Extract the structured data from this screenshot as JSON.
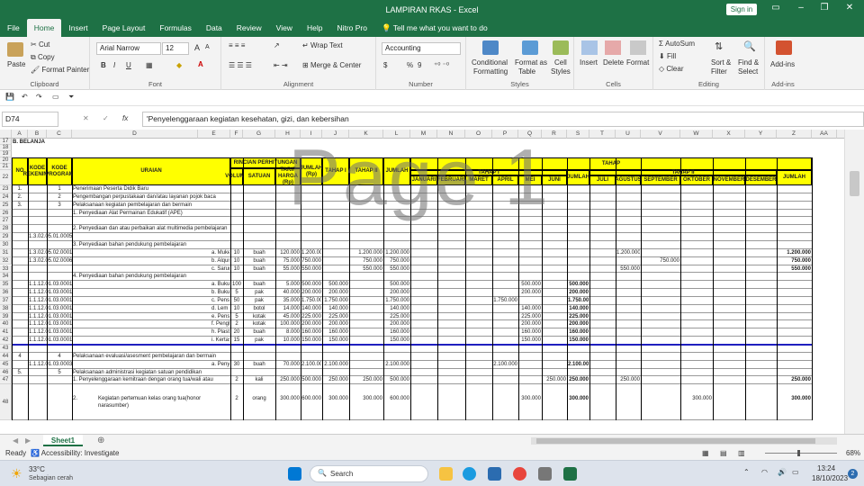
{
  "window": {
    "title": "LAMPIRAN RKAS  -  Excel",
    "signin": "Sign in"
  },
  "tabs": [
    "File",
    "Home",
    "Insert",
    "Page Layout",
    "Formulas",
    "Data",
    "Review",
    "View",
    "Help",
    "Nitro Pro"
  ],
  "tell_me": "Tell me what you want to do",
  "ribbon": {
    "clipboard": {
      "paste": "Paste",
      "cut": "Cut",
      "copy": "Copy",
      "format_painter": "Format Painter",
      "label": "Clipboard"
    },
    "font": {
      "name": "Arial Narrow",
      "size": "12",
      "bold": "B",
      "italic": "I",
      "underline": "U",
      "grow": "A",
      "shrink": "A",
      "label": "Font"
    },
    "alignment": {
      "wrap": "Wrap Text",
      "merge": "Merge & Center",
      "label": "Alignment"
    },
    "number": {
      "format": "Accounting",
      "pct": "%",
      "comma": "9",
      "label": "Number"
    },
    "styles": {
      "cond": "Conditional",
      "cond2": "Formatting",
      "fmt_table": "Format as",
      "fmt_table2": "Table",
      "cell": "Cell",
      "cell2": "Styles",
      "label": "Styles"
    },
    "cells": {
      "insert": "Insert",
      "delete": "Delete",
      "format": "Format",
      "label": "Cells"
    },
    "editing": {
      "autosum": "AutoSum",
      "fill": "Fill",
      "clear": "Clear",
      "sort": "Sort &",
      "sort2": "Filter",
      "find": "Find &",
      "find2": "Select",
      "label": "Editing"
    },
    "addins": {
      "btn": "Add-ins",
      "label": "Add-ins"
    }
  },
  "formula": {
    "namebox": "D74",
    "fx": "fx",
    "content": "'Penyelenggaraan kegiatan kesehatan, gizi, dan kebersihan"
  },
  "columns": [
    "A",
    "B",
    "C",
    "D",
    "E",
    "F",
    "G",
    "H",
    "I",
    "J",
    "K",
    "L",
    "M",
    "N",
    "O",
    "P",
    "Q",
    "R",
    "S",
    "T",
    "U",
    "V",
    "W",
    "X",
    "Y",
    "Z",
    "AA",
    "AB"
  ],
  "header": {
    "belanja": "B. BELANJA",
    "no": "NO",
    "kode_rek": "KODE REKENING",
    "kode_prog": "KODE PROGRAM",
    "uraian": "URAIAN",
    "rincian": "RINCIAN PERHITUNGAN",
    "volume": "VOLUME",
    "satuan": "SATUAN",
    "tarif": "TARIF HARGA (Rp)",
    "jumlah_rp": "JUMLAH (Rp)",
    "tahap1": "TAHAP I",
    "tahap2": "TAHAP II",
    "jumlah": "JUMLAH",
    "tahap": "TAHAP",
    "tahap1b": "TAHAP I",
    "tahap2b": "TAHAP II",
    "months": [
      "JANUARI",
      "FEBRUARI",
      "MARET",
      "APRIL",
      "MEI",
      "JUNI"
    ],
    "jumlah_a": "JUMLAH",
    "months2": [
      "JULI",
      "AGUSTUS",
      "SEPTEMBER",
      "OKTOBER",
      "NOVEMBER",
      "DESEMBER"
    ],
    "jumlah_b": "JUMLAH"
  },
  "rows": [
    {
      "r": "23",
      "a": "1.",
      "c": "1",
      "d": "Penerimaan Peserta Didik Baru"
    },
    {
      "r": "24",
      "a": "2.",
      "c": "2",
      "d": "Pengembangan perpustakaan dan/atau layanan pojok baca"
    },
    {
      "r": "25",
      "a": "3.",
      "c": "3",
      "d": "Pelaksanaan kegiatan pembelajaran dan bermain"
    },
    {
      "r": "26",
      "d": "1. Penyediaan Alat Permainan Edukatif (APE)"
    },
    {
      "r": "27"
    },
    {
      "r": "28",
      "d": "2. Penyediaan dan atau perbaikan alat multimedia pembelajaran"
    },
    {
      "r": "29",
      "b": "1.3.02.05.01.0005"
    },
    {
      "r": "30",
      "d": "3. Penyediaan bahan pendukung pembelajaran"
    },
    {
      "r": "31",
      "b": "1.3.02.05.02.0001",
      "e": "a. Mukena",
      "f": "10",
      "g": "buah",
      "h": "120.000",
      "i": "1.200.000",
      "k": "1.200.000",
      "l": "1.200.000",
      "u": "1.200.000",
      "z": "1.200.000"
    },
    {
      "r": "32",
      "b": "1.3.02.05.02.0006",
      "e": "b. Alquran",
      "f": "10",
      "g": "buah",
      "h": "75.000",
      "i": "750.000",
      "k": "750.000",
      "l": "750.000",
      "v": "750.000",
      "z": "750.000"
    },
    {
      "r": "33",
      "e": "c. Sarung anak",
      "f": "10",
      "g": "buah",
      "h": "55.000",
      "i": "550.000",
      "k": "550.000",
      "l": "550.000",
      "u": "550.000",
      "z": "550.000"
    },
    {
      "r": "34",
      "d": "4. Penyediaan bahan pendukung pembelajaran"
    },
    {
      "r": "35",
      "b": "1.1.12.01.03.0001",
      "e": "a. Buku gambar A4",
      "f": "100",
      "g": "buah",
      "h": "5.000",
      "i": "500.000",
      "j": "500.000",
      "l": "500.000",
      "q": "500.000",
      "s": "500.000"
    },
    {
      "r": "36",
      "b": "1.1.12.01.03.0001",
      "e": "b. Buku tulis",
      "f": "5",
      "g": "pak",
      "h": "40.000",
      "i": "200.000",
      "j": "200.000",
      "l": "200.000",
      "q": "200.000",
      "s": "200.000"
    },
    {
      "r": "37",
      "b": "1.1.12.01.03.0001",
      "e": "c. Pensil warna",
      "f": "50",
      "g": "pak",
      "h": "35.000",
      "i": "1.750.000",
      "j": "1.750.000",
      "l": "1.750.000",
      "p": "1.750.000",
      "s": "1.750.000"
    },
    {
      "r": "38",
      "b": "1.1.12.01.03.0001",
      "e": "d. Lem fox kecil",
      "f": "10",
      "g": "botol",
      "h": "14.000",
      "i": "140.000",
      "j": "140.000",
      "l": "140.000",
      "q": "140.000",
      "s": "140.000"
    },
    {
      "r": "39",
      "b": "1.1.12.01.03.0001",
      "e": "e. Pensil 2B",
      "f": "5",
      "g": "kotak",
      "h": "45.000",
      "i": "225.000",
      "j": "225.000",
      "l": "225.000",
      "q": "225.000",
      "s": "225.000"
    },
    {
      "r": "40",
      "b": "1.1.12.01.03.0001",
      "e": "f. Penghapus",
      "f": "2",
      "g": "kotak",
      "h": "100.000",
      "i": "200.000",
      "j": "200.000",
      "l": "200.000",
      "q": "200.000",
      "s": "200.000"
    },
    {
      "r": "41",
      "b": "1.1.12.01.03.0001",
      "e": "h. Plastisin",
      "f": "20",
      "g": "buah",
      "h": "8.000",
      "i": "160.000",
      "j": "160.000",
      "l": "160.000",
      "q": "160.000",
      "s": "160.000"
    },
    {
      "r": "42",
      "b": "1.1.12.01.03.0001",
      "e": "i. Kertas origami",
      "f": "15",
      "g": "pak",
      "h": "10.000",
      "i": "150.000",
      "j": "150.000",
      "l": "150.000",
      "q": "150.000",
      "s": "150.000"
    },
    {
      "r": "43"
    },
    {
      "r": "44",
      "a": "4",
      "c": "4",
      "d": "Pelaksanaan evaluasi/asesment pembelajaran dan bermain"
    },
    {
      "r": "45",
      "b": "1.1.12.01.03.0003",
      "e": "a. Penyediaan sampul raport",
      "f": "30",
      "g": "buah",
      "h": "70.000",
      "i": "2.100.000",
      "j": "2.100.000",
      "l": "2.100.000",
      "p": "2.100.000",
      "s": "2.100.000"
    },
    {
      "r": "46",
      "a": "5.",
      "c": "5",
      "d": "Pelaksanaan administrasi kegiatan satuan pendidikan"
    },
    {
      "r": "47",
      "d": "1. Penyelenggaraan kemitraan dengan orang tua/wali atau",
      "f": "2",
      "g": "kali",
      "h": "250.000",
      "i": "500.000",
      "j": "250.000",
      "k": "250.000",
      "l": "500.000",
      "r2": "250.000",
      "s": "250.000",
      "u": "250.000",
      "z": "250.000"
    },
    {
      "r": "48",
      "d": "2.",
      "e": "Kegiatan pertemuan kelas orang tua(honor narasumber)",
      "f": "2",
      "g": "orang",
      "h": "300.000",
      "i": "600.000",
      "j": "300.000",
      "k": "300.000",
      "l": "600.000",
      "q": "300.000",
      "s": "300.000",
      "w": "300.000",
      "z": "300.000"
    }
  ],
  "row_headers_top": [
    "17",
    "18",
    "19",
    "20",
    "21",
    "22"
  ],
  "watermark": "Page 1",
  "sheet": {
    "name": "Sheet1"
  },
  "status": {
    "ready": "Ready",
    "access": "Accessibility: Investigate",
    "zoom": "68%"
  },
  "taskbar": {
    "temp": "33°C",
    "weather": "Sebagian cerah",
    "search": "Search",
    "time": "13:24",
    "date": "18/10/2023"
  }
}
